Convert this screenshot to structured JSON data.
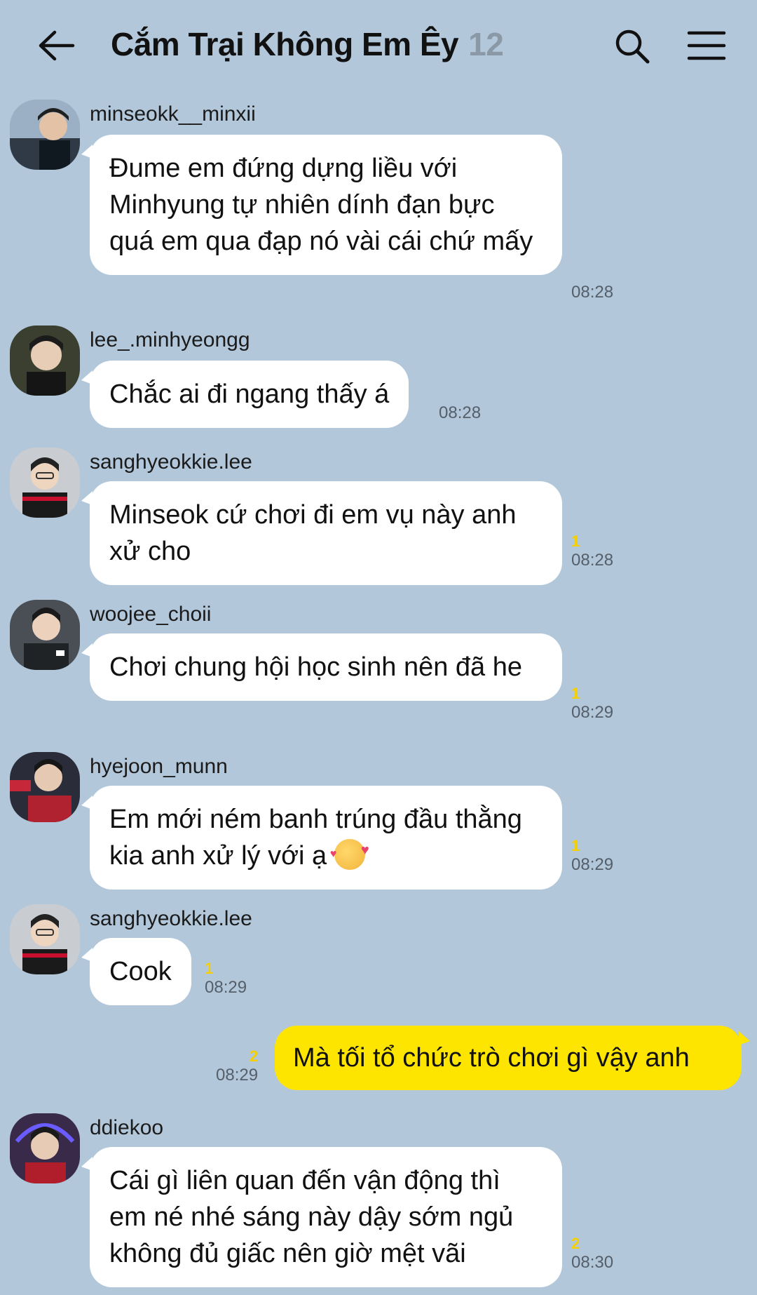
{
  "header": {
    "title": "Cắm Trại Không Em Êy",
    "member_count": "12",
    "icons": {
      "back": "arrow-left-icon",
      "search": "search-icon",
      "menu": "hamburger-menu-icon"
    }
  },
  "colors": {
    "background": "#b2c7da",
    "incoming_bubble": "#ffffff",
    "outgoing_bubble": "#fee500",
    "unread_count": "#f7d000"
  },
  "messages": [
    {
      "sender": "minseokk__minxii",
      "text": "Đume em đứng dựng liều với Minhyung tự nhiên dính đạn bực quá em qua đạp nó vài cái chứ mấy",
      "time": "08:28",
      "unread": ""
    },
    {
      "sender": "lee_.minhyeongg",
      "text": "Chắc ai đi ngang thấy á",
      "time": "08:28",
      "unread": ""
    },
    {
      "sender": "sanghyeokkie.lee",
      "text": "Minseok cứ chơi đi em vụ này anh xử cho",
      "time": "08:28",
      "unread": "1"
    },
    {
      "sender": "woojee_choii",
      "text": "Chơi chung hội học sinh nên đã he",
      "time": "08:29",
      "unread": "1"
    },
    {
      "sender": "hyejoon_munn",
      "text": "Em mới ném banh trúng đầu thằng kia anh xử lý với ạ",
      "emoji": "smiling-face-with-hearts-emoji",
      "time": "08:29",
      "unread": "1"
    },
    {
      "sender": "sanghyeokkie.lee",
      "text": "Cook",
      "time": "08:29",
      "unread": "1"
    },
    {
      "sender": "me",
      "text": "Mà tối tổ chức trò chơi gì vậy anh",
      "time": "08:29",
      "unread": "2"
    },
    {
      "sender": "ddiekoo",
      "text": "Cái gì liên quan đến vận động thì em né nhé sáng này dậy sớm ngủ không đủ giấc nên giờ mệt vãi",
      "time": "08:30",
      "unread": "2"
    }
  ]
}
